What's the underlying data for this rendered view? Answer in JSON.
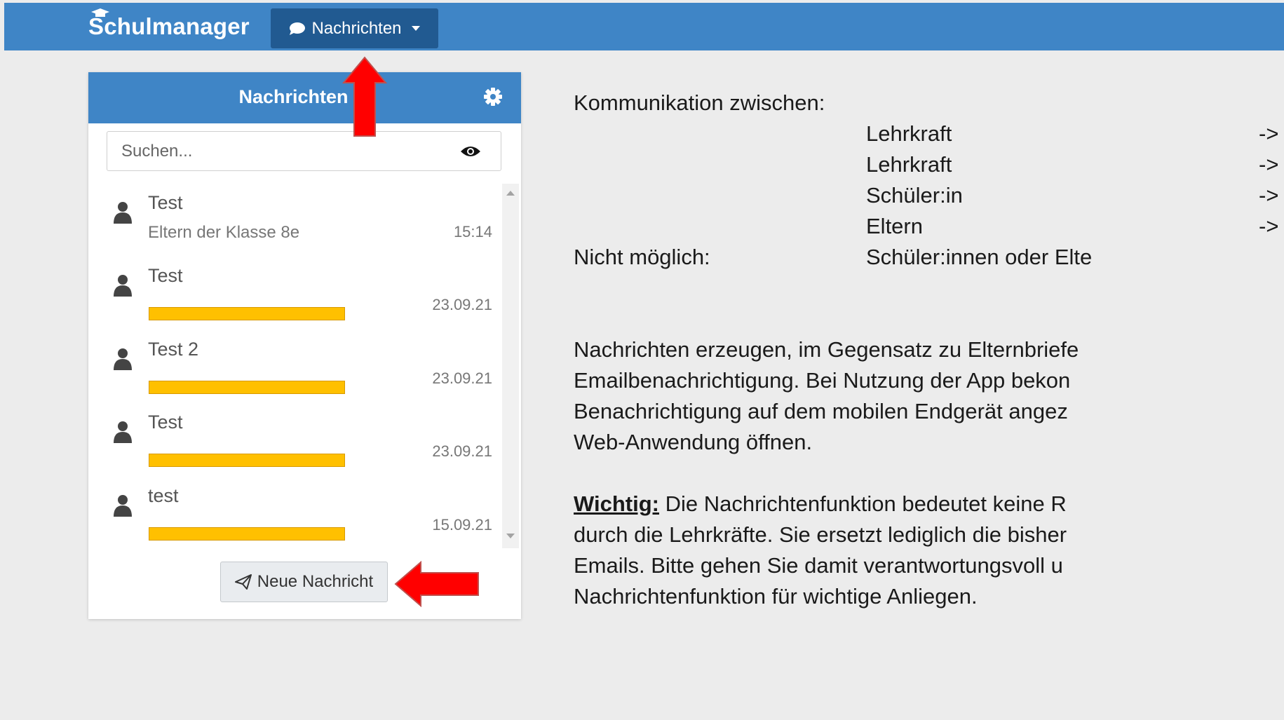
{
  "app": {
    "logo": "Schulmanager",
    "nav_button": "Nachrichten"
  },
  "panel": {
    "title": "Nachrichten",
    "search_placeholder": "Suchen...",
    "new_message_button": "Neue Nachricht",
    "messages": [
      {
        "title": "Test",
        "recipient": "Eltern der Klasse 8e",
        "time": "15:14",
        "redacted": false
      },
      {
        "title": "Test",
        "recipient": "",
        "time": "23.09.21",
        "redacted": true
      },
      {
        "title": "Test 2",
        "recipient": "",
        "time": "23.09.21",
        "redacted": true
      },
      {
        "title": "Test",
        "recipient": "",
        "time": "23.09.21",
        "redacted": true
      },
      {
        "title": "test",
        "recipient": "",
        "time": "15.09.21",
        "redacted": true
      }
    ]
  },
  "info": {
    "komm_label": "Kommunikation zwischen:",
    "rows": [
      {
        "from": "Lehrkraft",
        "arrow": "->"
      },
      {
        "from": "Lehrkraft",
        "arrow": "->"
      },
      {
        "from": "Schüler:in",
        "arrow": "->"
      },
      {
        "from": "Eltern",
        "arrow": "->"
      }
    ],
    "nicht_label": "Nicht möglich:",
    "nicht_value": "Schüler:innen oder Elte",
    "para1": [
      "Nachrichten erzeugen, im Gegensatz zu Elternbriefe",
      "Emailbenachrichtigung. Bei Nutzung der App bekon",
      "Benachrichtigung auf dem mobilen Endgerät angez",
      "Web-Anwendung öffnen."
    ],
    "wichtig_label": "Wichtig:",
    "para2_first": " Die Nachrichtenfunktion bedeutet keine R",
    "para2": [
      "durch die Lehrkräfte. Sie ersetzt lediglich die bisher",
      "Emails. Bitte gehen Sie damit verantwortungsvoll u",
      "Nachrichtenfunktion für wichtige Anliegen."
    ]
  },
  "colors": {
    "brand_blue": "#3f85c6",
    "nav_dark": "#215a91",
    "redaction": "#ffc000",
    "annotation_red": "#ff0000"
  }
}
